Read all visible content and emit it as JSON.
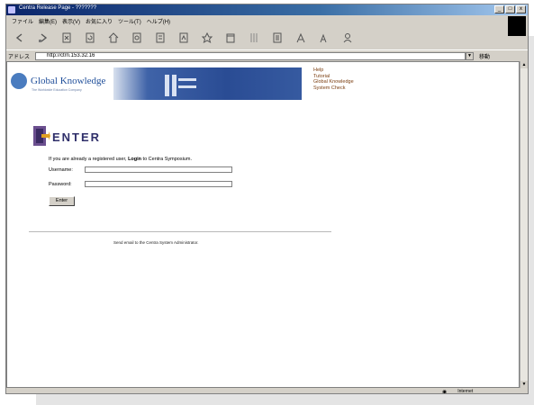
{
  "window": {
    "title": "Centra Release Page - ???????",
    "min_label": "_",
    "max_label": "□",
    "close_label": "x"
  },
  "menu": [
    "ファイル",
    "編集(E)",
    "表示(V)",
    "お気に入り",
    "ツール(T)",
    "ヘルプ(H)"
  ],
  "toolbar": {
    "icons": [
      "back-icon",
      "forward-icon",
      "stop-icon",
      "refresh-icon",
      "home-icon",
      "search-icon",
      "favorites-icon",
      "history-icon",
      "mail-icon",
      "print-icon",
      "edit-icon",
      "discuss-icon",
      "messenger-icon"
    ]
  },
  "address": {
    "label": "アドレス",
    "url": "http://ctrn.153.32.16",
    "go_label": "移動"
  },
  "banner": {
    "logo_text": "Global Knowledge",
    "logo_tagline": "The Worldwide Education Company",
    "links": [
      "Help",
      "Tutorial",
      "Global Knowledge",
      "System Check"
    ]
  },
  "enter": {
    "title": "ENTER",
    "intro_before": "If you are already a registered user, ",
    "intro_bold": "Login",
    "intro_after": " to Centra Symposium."
  },
  "form": {
    "username_label": "Username:",
    "password_label": "Password:",
    "submit_label": "Enter",
    "username_value": "",
    "password_value": ""
  },
  "footer": {
    "text": "Send email to the Centra System Administrator."
  },
  "status": {
    "text": "",
    "zone": "Internet"
  },
  "colors": {
    "titlebar": "#0a246a",
    "link": "#7a3d0f",
    "banner_blue": "#2a4c94"
  }
}
